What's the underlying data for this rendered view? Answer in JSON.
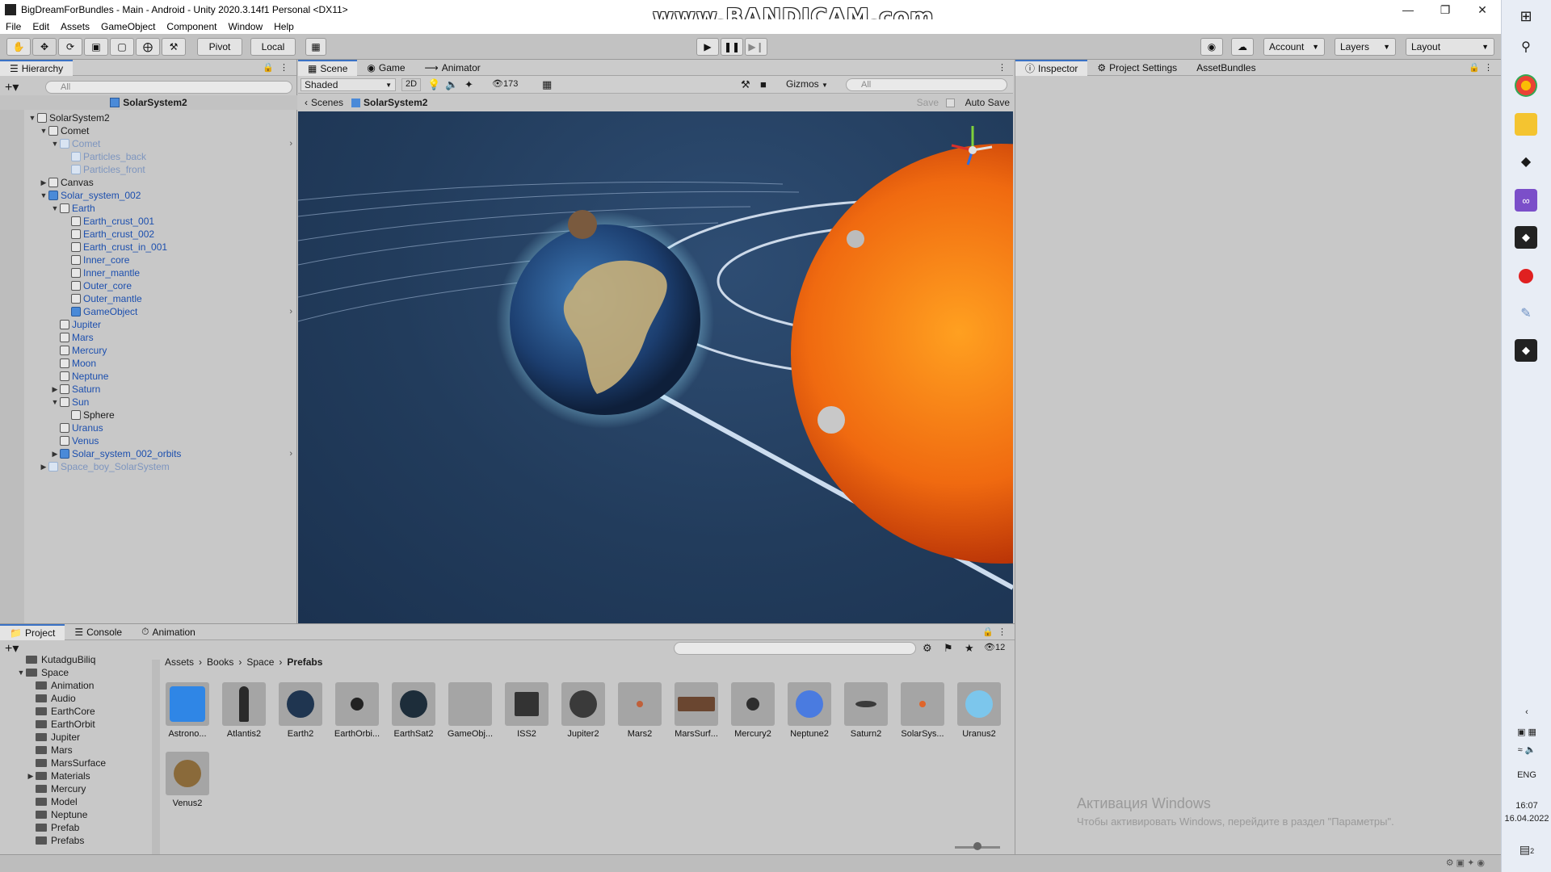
{
  "window": {
    "title": "BigDreamForBundles - Main - Android - Unity 2020.3.14f1 Personal <DX11>",
    "watermark": "www.BANDICAM.com"
  },
  "menu": [
    "File",
    "Edit",
    "Assets",
    "GameObject",
    "Component",
    "Window",
    "Help"
  ],
  "toolbar": {
    "pivot": "Pivot",
    "local": "Local",
    "account": "Account",
    "layers": "Layers",
    "layout": "Layout"
  },
  "hierarchy": {
    "tab": "Hierarchy",
    "search_placeholder": "All",
    "scene_name": "SolarSystem2",
    "items": [
      {
        "label": "SolarSystem2",
        "depth": 0,
        "arrow": "down",
        "kind": "normal"
      },
      {
        "label": "Comet",
        "depth": 1,
        "arrow": "down",
        "kind": "normal"
      },
      {
        "label": "Comet",
        "depth": 2,
        "arrow": "down",
        "kind": "ghostprefab",
        "more": true
      },
      {
        "label": "Particles_back",
        "depth": 3,
        "arrow": "",
        "kind": "ghost"
      },
      {
        "label": "Particles_front",
        "depth": 3,
        "arrow": "",
        "kind": "ghost"
      },
      {
        "label": "Canvas",
        "depth": 1,
        "arrow": "right",
        "kind": "normal"
      },
      {
        "label": "Solar_system_002",
        "depth": 1,
        "arrow": "down",
        "kind": "prefab"
      },
      {
        "label": "Earth",
        "depth": 2,
        "arrow": "down",
        "kind": "prefabtext"
      },
      {
        "label": "Earth_crust_001",
        "depth": 3,
        "arrow": "",
        "kind": "prefabtext"
      },
      {
        "label": "Earth_crust_002",
        "depth": 3,
        "arrow": "",
        "kind": "prefabtext"
      },
      {
        "label": "Earth_crust_in_001",
        "depth": 3,
        "arrow": "",
        "kind": "prefabtext"
      },
      {
        "label": "Inner_core",
        "depth": 3,
        "arrow": "",
        "kind": "prefabtext"
      },
      {
        "label": "Inner_mantle",
        "depth": 3,
        "arrow": "",
        "kind": "prefabtext"
      },
      {
        "label": "Outer_core",
        "depth": 3,
        "arrow": "",
        "kind": "prefabtext"
      },
      {
        "label": "Outer_mantle",
        "depth": 3,
        "arrow": "",
        "kind": "prefabtext"
      },
      {
        "label": "GameObject",
        "depth": 3,
        "arrow": "",
        "kind": "prefab",
        "more": true
      },
      {
        "label": "Jupiter",
        "depth": 2,
        "arrow": "",
        "kind": "prefabtext"
      },
      {
        "label": "Mars",
        "depth": 2,
        "arrow": "",
        "kind": "prefabtext"
      },
      {
        "label": "Mercury",
        "depth": 2,
        "arrow": "",
        "kind": "prefabtext"
      },
      {
        "label": "Moon",
        "depth": 2,
        "arrow": "",
        "kind": "prefabtext"
      },
      {
        "label": "Neptune",
        "depth": 2,
        "arrow": "",
        "kind": "prefabtext"
      },
      {
        "label": "Saturn",
        "depth": 2,
        "arrow": "right",
        "kind": "prefabtext"
      },
      {
        "label": "Sun",
        "depth": 2,
        "arrow": "down",
        "kind": "prefabtext"
      },
      {
        "label": "Sphere",
        "depth": 3,
        "arrow": "",
        "kind": "normal"
      },
      {
        "label": "Uranus",
        "depth": 2,
        "arrow": "",
        "kind": "prefabtext"
      },
      {
        "label": "Venus",
        "depth": 2,
        "arrow": "",
        "kind": "prefabtext"
      },
      {
        "label": "Solar_system_002_orbits",
        "depth": 2,
        "arrow": "right",
        "kind": "prefab",
        "more": true
      },
      {
        "label": "Space_boy_SolarSystem",
        "depth": 1,
        "arrow": "right",
        "kind": "ghostprefab"
      }
    ]
  },
  "scene": {
    "tabs": [
      "Scene",
      "Game",
      "Animator"
    ],
    "shading": "Shaded",
    "mode_2d": "2D",
    "hidden_count": "173",
    "gizmos": "Gizmos",
    "search_placeholder": "All",
    "breadcrumb_root": "Scenes",
    "breadcrumb_current": "SolarSystem2",
    "save": "Save",
    "auto_save": "Auto Save"
  },
  "inspector": {
    "tabs": [
      "Inspector",
      "Project Settings",
      "AssetBundles"
    ],
    "activate_title": "Активация Windows",
    "activate_sub": "Чтобы активировать Windows, перейдите в раздел \"Параметры\"."
  },
  "project": {
    "tabs": [
      "Project",
      "Console",
      "Animation"
    ],
    "badge_count": "12",
    "breadcrumb": [
      "Assets",
      "Books",
      "Space",
      "Prefabs"
    ],
    "tree": [
      {
        "label": "KutadguBiliq",
        "depth": 1,
        "arrow": ""
      },
      {
        "label": "Space",
        "depth": 1,
        "arrow": "down"
      },
      {
        "label": "Animation",
        "depth": 2,
        "arrow": ""
      },
      {
        "label": "Audio",
        "depth": 2,
        "arrow": ""
      },
      {
        "label": "EarthCore",
        "depth": 2,
        "arrow": ""
      },
      {
        "label": "EarthOrbit",
        "depth": 2,
        "arrow": ""
      },
      {
        "label": "Jupiter",
        "depth": 2,
        "arrow": ""
      },
      {
        "label": "Mars",
        "depth": 2,
        "arrow": ""
      },
      {
        "label": "MarsSurface",
        "depth": 2,
        "arrow": ""
      },
      {
        "label": "Materials",
        "depth": 2,
        "arrow": "right"
      },
      {
        "label": "Mercury",
        "depth": 2,
        "arrow": ""
      },
      {
        "label": "Model",
        "depth": 2,
        "arrow": ""
      },
      {
        "label": "Neptune",
        "depth": 2,
        "arrow": ""
      },
      {
        "label": "Prefab",
        "depth": 2,
        "arrow": ""
      },
      {
        "label": "Prefabs",
        "depth": 2,
        "arrow": ""
      }
    ],
    "assets": [
      {
        "label": "Astrono...",
        "color": "#2f86e6",
        "shape": "cube"
      },
      {
        "label": "Atlantis2",
        "color": "#2a2a2a",
        "shape": "shuttle"
      },
      {
        "label": "Earth2",
        "color": "#1f3550",
        "shape": "ball"
      },
      {
        "label": "EarthOrbi...",
        "color": "#222222",
        "shape": "small"
      },
      {
        "label": "EarthSat2",
        "color": "#1d2d3a",
        "shape": "ball"
      },
      {
        "label": "GameObj...",
        "color": "#a5a5a5",
        "shape": "none"
      },
      {
        "label": "ISS2",
        "color": "#333333",
        "shape": "iss"
      },
      {
        "label": "Jupiter2",
        "color": "#3a3a3a",
        "shape": "ball"
      },
      {
        "label": "Mars2",
        "color": "#c0603a",
        "shape": "tiny"
      },
      {
        "label": "MarsSurf...",
        "color": "#6a4630",
        "shape": "flat"
      },
      {
        "label": "Mercury2",
        "color": "#2e2e2e",
        "shape": "small"
      },
      {
        "label": "Neptune2",
        "color": "#4a7be0",
        "shape": "ball"
      },
      {
        "label": "Saturn2",
        "color": "#3a3a3a",
        "shape": "ring"
      },
      {
        "label": "SolarSys...",
        "color": "#e0652a",
        "shape": "tiny"
      },
      {
        "label": "Uranus2",
        "color": "#7cc6ec",
        "shape": "ball"
      },
      {
        "label": "Venus2",
        "color": "#8a6a3a",
        "shape": "ball"
      }
    ]
  },
  "taskbar": {
    "lang": "ENG",
    "time": "16:07",
    "date": "16.04.2022",
    "notif": "2"
  }
}
